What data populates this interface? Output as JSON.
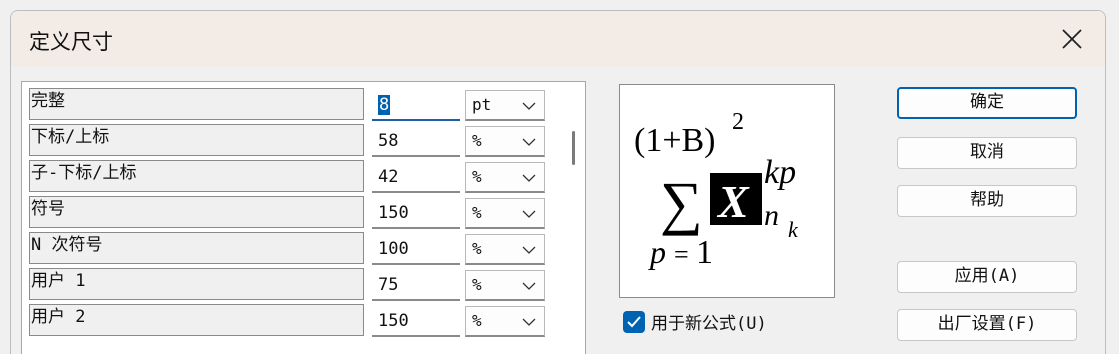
{
  "window": {
    "title": "定义尺寸"
  },
  "sizes": [
    {
      "label": "完整",
      "value": "8",
      "unit": "pt"
    },
    {
      "label": "下标/上标",
      "value": "58",
      "unit": "%"
    },
    {
      "label": "子-下标/上标",
      "value": "42",
      "unit": "%"
    },
    {
      "label": "符号",
      "value": "150",
      "unit": "%"
    },
    {
      "label": "N 次符号",
      "value": "100",
      "unit": "%"
    },
    {
      "label": "用户 1",
      "value": "75",
      "unit": "%"
    },
    {
      "label": "用户 2",
      "value": "150",
      "unit": "%"
    }
  ],
  "preview": {
    "base": "(1+B)",
    "exp": "2",
    "sigma": "∑",
    "lower": "p",
    "eq": "=",
    "one": "1",
    "var": "X",
    "sup": "kp",
    "sub_n": "n",
    "sub_k": "k"
  },
  "checkbox": {
    "label": "用于新公式(U)",
    "checked": true
  },
  "buttons": {
    "ok": "确定",
    "cancel": "取消",
    "help": "帮助",
    "apply": "应用(A)",
    "factory": "出厂设置(F)"
  },
  "colors": {
    "accent": "#0063b1",
    "titlebar": "#f3ebe6"
  }
}
